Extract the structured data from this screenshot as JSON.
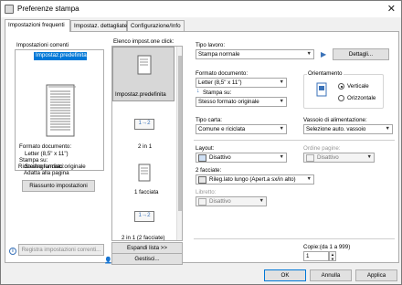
{
  "window": {
    "title": "Preferenze stampa"
  },
  "tabs": [
    {
      "label": "Impostazioni frequenti"
    },
    {
      "label": "Impostaz. dettagliate"
    },
    {
      "label": "Configurazione/Info"
    }
  ],
  "current": {
    "heading": "Impostazioni correnti",
    "selected": "Impostaz.predefinita",
    "summary": [
      "Formato documento:",
      "Letter (8,5\" x 11\")",
      "Stampa su:",
      "Stesso formato originale",
      "Riduci/Ingrandisci:",
      "Adatta alla pagina"
    ],
    "reset_label": "Riassunto impostazioni",
    "register_label": "Registra impostazioni correnti..."
  },
  "oneclick": {
    "heading": "Elenco impost.one click:",
    "items": [
      {
        "label": "Impostaz.predefinita",
        "glyph": ""
      },
      {
        "label": "2 in 1",
        "glyph": "1→2"
      },
      {
        "label": "1 facciata",
        "glyph": ""
      },
      {
        "label": "2 in 1 (2 facciate)",
        "glyph": "1→2"
      }
    ],
    "expand_label": "Espandi lista >>",
    "manage_label": "Gestisci..."
  },
  "settings": {
    "job_type_label": "Tipo lavoro:",
    "job_type_value": "Stampa normale",
    "details_label": "Dettagli...",
    "doc_size_label": "Formato documento:",
    "doc_size_value": "Letter (8,5\" x 11\")",
    "print_on_label": "Stampa su:",
    "print_on_value": "Stesso formato originale",
    "orientation_label": "Orientamento",
    "portrait_label": "Verticale",
    "landscape_label": "Orizzontale",
    "paper_type_label": "Tipo carta:",
    "paper_type_value": "Comune e riciclata",
    "tray_label": "Vassoio di alimentazione:",
    "tray_value": "Selezione auto. vassoio",
    "layout_label": "Layout:",
    "layout_value": "Disattivo",
    "page_order_label": "Ordine pagine:",
    "page_order_value": "Disattivo",
    "duplex_label": "2 facciate:",
    "duplex_value": "Rileg.lato lungo (Apert.a sx/in alto)",
    "booklet_label": "Libretto:",
    "booklet_value": "Disattivo",
    "copies_label": "Copie:(da 1 a 999)",
    "copies_value": "1"
  },
  "footer": {
    "ok": "OK",
    "cancel": "Annulla",
    "apply": "Applica"
  }
}
